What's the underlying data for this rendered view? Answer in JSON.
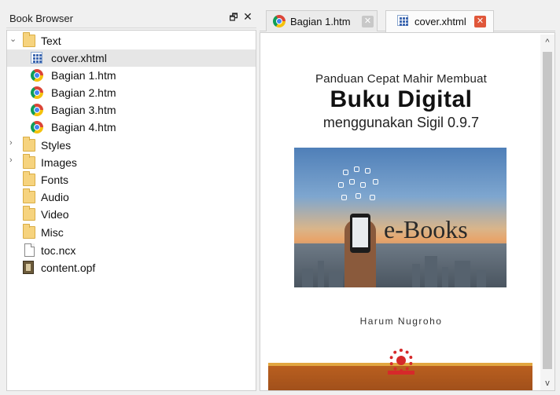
{
  "book_browser": {
    "title": "Book Browser",
    "float_glyph": "🗗",
    "close_glyph": "✕",
    "tree": [
      {
        "label": "Text",
        "icon": "folder-icon",
        "expander": "expanded"
      },
      {
        "label": "cover.xhtml",
        "icon": "xhtml-file-icon",
        "selected": true
      },
      {
        "label": "Bagian 1.htm",
        "icon": "chrome-icon"
      },
      {
        "label": "Bagian 2.htm",
        "icon": "chrome-icon"
      },
      {
        "label": "Bagian 3.htm",
        "icon": "chrome-icon"
      },
      {
        "label": "Bagian 4.htm",
        "icon": "chrome-icon"
      },
      {
        "label": "Styles",
        "icon": "folder-icon",
        "expander": "collapsed"
      },
      {
        "label": "Images",
        "icon": "folder-icon",
        "expander": "collapsed"
      },
      {
        "label": "Fonts",
        "icon": "folder-icon"
      },
      {
        "label": "Audio",
        "icon": "folder-icon"
      },
      {
        "label": "Video",
        "icon": "folder-icon"
      },
      {
        "label": "Misc",
        "icon": "folder-icon"
      },
      {
        "label": "toc.ncx",
        "icon": "file-icon"
      },
      {
        "label": "content.opf",
        "icon": "opf-book-icon"
      }
    ]
  },
  "editor": {
    "tabs": [
      {
        "label": "Bagian 1.htm",
        "icon": "chrome-icon",
        "close": "✕",
        "active": false
      },
      {
        "label": "cover.xhtml",
        "icon": "xhtml-file-icon",
        "close": "✕",
        "active": true
      }
    ],
    "cover": {
      "subtitle_top": "Panduan Cepat Mahir Membuat",
      "title": "Buku Digital",
      "subtitle_bottom": "menggunakan Sigil 0.9.7",
      "image_text": "e-Books",
      "author": "Harum Nugroho"
    },
    "scroll": {
      "up": "^",
      "down": "v"
    }
  },
  "colors": {
    "selected_row": "#e6e6e6",
    "tab_close_active": "#e0573a",
    "footer_bar": "#a1501b",
    "logo_red": "#d6292a"
  }
}
